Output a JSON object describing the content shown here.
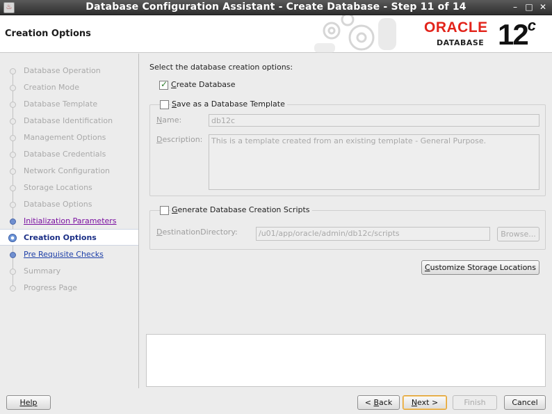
{
  "window": {
    "title": "Database Configuration Assistant - Create Database - Step 11 of 14",
    "minimize": "–",
    "maximize": "□",
    "close": "✕"
  },
  "header": {
    "page_title": "Creation Options",
    "brand": "ORACLE",
    "brand_sub": "DATABASE",
    "version": "12",
    "version_suffix": "c"
  },
  "steps": [
    {
      "label": "Database Operation",
      "state": "done"
    },
    {
      "label": "Creation Mode",
      "state": "done"
    },
    {
      "label": "Database Template",
      "state": "done"
    },
    {
      "label": "Database Identification",
      "state": "done"
    },
    {
      "label": "Management Options",
      "state": "done"
    },
    {
      "label": "Database Credentials",
      "state": "done"
    },
    {
      "label": "Network Configuration",
      "state": "done"
    },
    {
      "label": "Storage Locations",
      "state": "done"
    },
    {
      "label": "Database Options",
      "state": "done"
    },
    {
      "label": "Initialization Parameters",
      "state": "link"
    },
    {
      "label": "Creation Options",
      "state": "current"
    },
    {
      "label": "Pre Requisite Checks",
      "state": "link"
    },
    {
      "label": "Summary",
      "state": "pending"
    },
    {
      "label": "Progress Page",
      "state": "pending"
    }
  ],
  "main": {
    "intro": "Select the database creation options:",
    "create_db": {
      "label_first": "C",
      "label_rest": "reate Database",
      "checked": true
    },
    "save_template": {
      "label_first": "S",
      "label_rest": "ave as a Database Template",
      "checked": false,
      "name_label_first": "N",
      "name_label_rest": "ame:",
      "name_value": "db12c",
      "desc_label_first": "D",
      "desc_label_rest": "escription:",
      "desc_value": "This is a template created from an existing template - General Purpose."
    },
    "scripts": {
      "label_first": "G",
      "label_rest": "enerate Database Creation Scripts",
      "checked": false,
      "dest_label_first": "D",
      "dest_label_rest": "estinationDirectory:",
      "dest_value": "/u01/app/oracle/admin/db12c/scripts",
      "browse": "Browse..."
    },
    "customize_first": "C",
    "customize_rest": "ustomize Storage Locations"
  },
  "footer": {
    "help": "Help",
    "back_prefix": "< ",
    "back_first": "B",
    "back_rest": "ack",
    "next_first": "N",
    "next_rest": "ext >",
    "finish": "Finish",
    "cancel": "Cancel"
  }
}
